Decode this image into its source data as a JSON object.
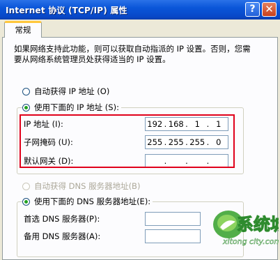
{
  "window": {
    "title": "Internet 协议 (TCP/IP) 属性",
    "help_glyph": "?",
    "close_glyph": "✕"
  },
  "tabs": {
    "general": "常规"
  },
  "intro_text": "如果网络支持此功能，则可以获取自动指派的 IP 设置。否则，您需要从网络系统管理员处获得适当的 IP 设置。",
  "ip": {
    "auto_option": "自动获得 IP 地址 (O)",
    "manual_option": "使用下面的 IP 地址 (S):",
    "address_label": "IP 地址 (I):",
    "address_value": [
      "192",
      "168",
      "1",
      "1"
    ],
    "subnet_label": "子网掩码 (U):",
    "subnet_value": [
      "255",
      "255",
      "255",
      "0"
    ],
    "gateway_label": "默认网关 (D):",
    "gateway_value": [
      "",
      "",
      "",
      ""
    ]
  },
  "dns": {
    "auto_option": "自动获得 DNS 服务器地址(B)",
    "manual_option": "使用下面的 DNS 服务器地址(E):",
    "preferred_label": "首选 DNS 服务器(P):",
    "alternate_label": "备用 DNS 服务器(A):"
  },
  "watermark": {
    "brand": "系统城",
    "url": "xitong city.com"
  },
  "colors": {
    "title_bar": "#0A56D9",
    "highlight_box": "#E0001A",
    "tab_accent": "#FFC73C"
  }
}
